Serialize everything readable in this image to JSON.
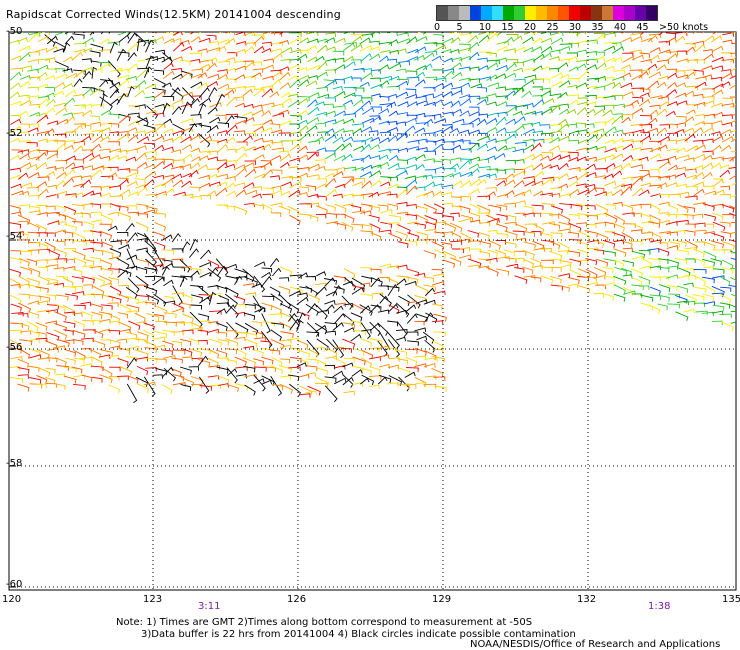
{
  "title": "Rapidscat Corrected Winds(12.5KM) 20141004 descending",
  "legend": {
    "colors": [
      "#555555",
      "#888888",
      "#bbbbbb",
      "#0044dd",
      "#00aaff",
      "#33ddff",
      "#00aa00",
      "#33cc33",
      "#ffee00",
      "#ffbb00",
      "#ff8800",
      "#ff5500",
      "#ee0000",
      "#bb0000",
      "#883311",
      "#cc7733",
      "#dd00dd",
      "#aa00cc",
      "#6600aa",
      "#330066"
    ],
    "labels": [
      "0",
      "5",
      "10",
      "15",
      "20",
      "25",
      "30",
      "35",
      "40",
      "45",
      ">50 knots"
    ],
    "unit_note": ">50 knots"
  },
  "axes": {
    "latitudes": [
      "-50",
      "-52",
      "-54",
      "-56",
      "-58",
      "-60"
    ],
    "longitudes": [
      "120",
      "123",
      "126",
      "129",
      "132",
      "135"
    ]
  },
  "time_labels": [
    {
      "text": "3:11"
    },
    {
      "text": "1:38"
    }
  ],
  "notes": [
    "Note: 1) Times are GMT 2)Times along bottom correspond to measurement at -50S",
    "3)Data buffer is 22 hrs from 20141004 4) Black circles indicate possible contamination"
  ],
  "credit": "NOAA/NESDIS/Office of Research and Applications"
}
